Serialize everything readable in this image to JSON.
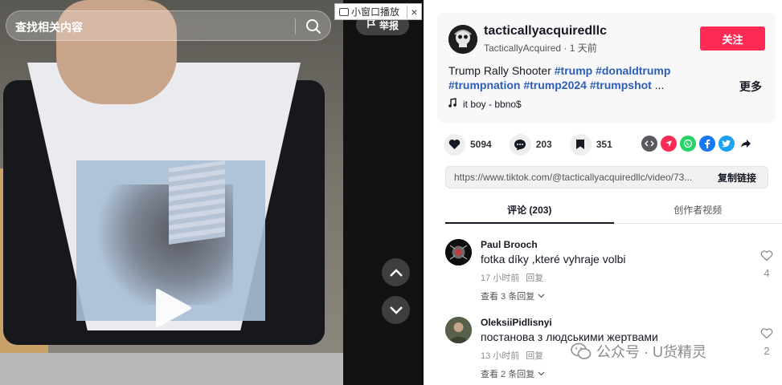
{
  "video": {
    "search_placeholder": "查找相关内容",
    "pip_label": "小窗口播放",
    "pip_close": "×",
    "report_label": "举报"
  },
  "author": {
    "display_name": "tacticallyacquiredllc",
    "handle": "TacticallyAcquired",
    "time_ago": "1 天前",
    "follow_label": "关注"
  },
  "post": {
    "title": "Trump Rally Shooter",
    "hashtags": [
      "#trump",
      "#donaldtrump",
      "#trumpnation",
      "#trump2024",
      "#trumpshot"
    ],
    "ellipsis": "...",
    "more_label": "更多",
    "music": "it boy - bbno$"
  },
  "stats": {
    "likes": "5094",
    "comments": "203",
    "saves": "351"
  },
  "share": {
    "link": "https://www.tiktok.com/@tacticallyacquiredllc/video/73...",
    "copy_label": "复制链接"
  },
  "tabs": [
    {
      "label": "评论 (203)",
      "active": true
    },
    {
      "label": "创作者视频",
      "active": false
    }
  ],
  "comments": [
    {
      "author": "Paul Brooch",
      "text": "fotka díky ,které vyhraje volbi",
      "time": "17 小时前",
      "reply_label": "回复",
      "replies_label": "查看 3 条回复",
      "likes": "4"
    },
    {
      "author": "OleksiiPidlisnyi",
      "text": "постанова з людськими жертвами",
      "time": "13 小时前",
      "reply_label": "回复",
      "replies_label": "查看 2 条回复",
      "likes": "2"
    }
  ],
  "watermark": {
    "text": "公众号 · U货精灵"
  },
  "colors": {
    "accent": "#fe2c55",
    "hashtag": "#2b5db9"
  }
}
